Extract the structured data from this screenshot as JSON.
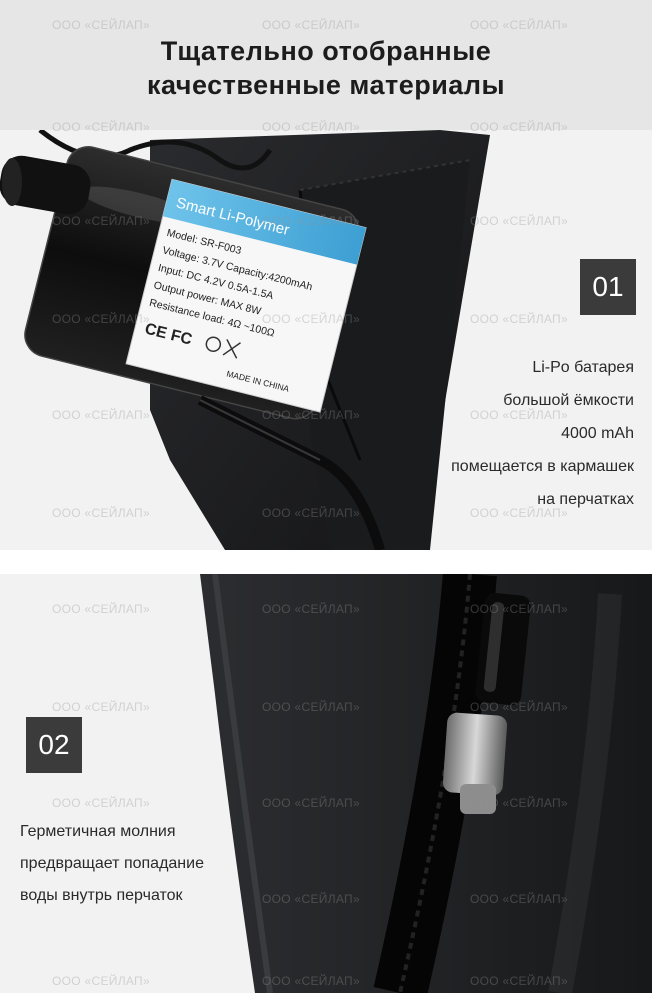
{
  "header": {
    "title_line1": "Тщательно отобранные",
    "title_line2": "качественные материалы"
  },
  "feature1": {
    "number": "01",
    "lines": [
      "Li-Po батарея",
      "большой ёмкости",
      "4000 mAh",
      "помещается в кармашек",
      "на перчатках"
    ],
    "battery_label": {
      "brand": "Smart Li-Polymer",
      "model": "Model: SR-F003",
      "voltage": "Voltage: 3.7V Capacity:4200mAh",
      "input": "Input: DC 4.2V   0.5A-1.5A",
      "output": "Output power: MAX 8W",
      "resistance": "Resistance load:   4Ω ~100Ω",
      "marks": "CE FC",
      "made_in": "MADE IN CHINA"
    }
  },
  "feature2": {
    "number": "02",
    "lines": [
      "Герметичная молния",
      "предвращает попадание",
      "воды внутрь перчаток"
    ]
  },
  "watermark": "ООО «СЕЙЛАП»",
  "colors": {
    "header_bg": "#e6e6e6",
    "badge_bg": "#3b3b3b",
    "panel_bg": "#f2f2f2",
    "fabric": "#1e1f21"
  }
}
